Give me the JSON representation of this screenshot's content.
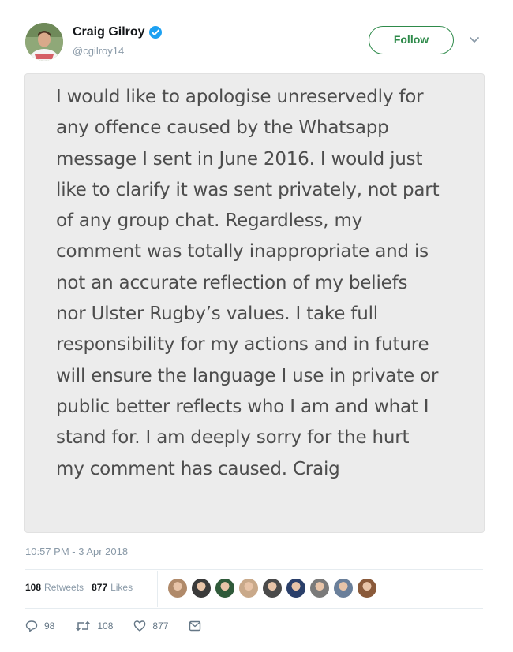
{
  "author": {
    "display_name": "Craig Gilroy",
    "handle": "@cgilroy14",
    "verified": true
  },
  "follow_label": "Follow",
  "statement": "I would like to apologise unreservedly for any offence caused by the Whatsapp message I sent in June 2016. I would just like to clarify it was sent privately, not part of any group chat. Regardless, my comment was totally inappropriate and is not an accurate reflection of my beliefs nor Ulster Rugby’s values. I take full responsibility for my actions and in future will ensure the language I use in private or public better reflects who I am and what I stand for. I am deeply sorry for the hurt my comment has caused. Craig",
  "statement_lines": [
    "I would like to apologise unreservedly for",
    "any offence caused by the Whatsapp",
    "message I sent in June 2016. I would just",
    "like to clarify it was sent privately, not part",
    "of any group chat. Regardless, my",
    "comment was totally inappropriate and is",
    "not an accurate reflection of my beliefs",
    "nor Ulster Rugby’s values. I take full",
    "responsibility for my actions and in future",
    "will ensure the language I use in private or",
    "public better reflects who I am and what I",
    "stand for. I am deeply sorry for the hurt",
    "my comment has caused. Craig"
  ],
  "timestamp": "10:57 PM - 3 Apr 2018",
  "stats": {
    "retweets_count": "108",
    "retweets_label": "Retweets",
    "likes_count": "877",
    "likes_label": "Likes"
  },
  "liker_avatars": [
    "#b08a6a",
    "#3a3a3a",
    "#2f5a3a",
    "#c9a98a",
    "#4a4a4a",
    "#2a3f6a",
    "#7a7a7a",
    "#6a7f9a",
    "#8a5a3a"
  ],
  "actions": {
    "reply_count": "98",
    "retweet_count": "108",
    "like_count": "877"
  },
  "colors": {
    "follow_accent": "#2e8a4a",
    "verified_blue": "#1da1f2",
    "card_background": "#ececec"
  }
}
